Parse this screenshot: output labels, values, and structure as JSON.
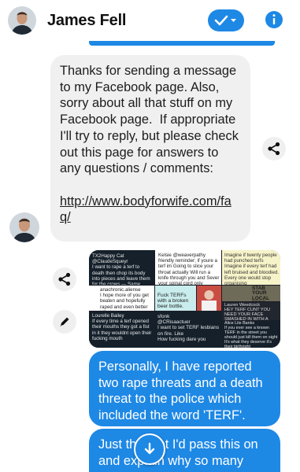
{
  "header": {
    "contact_name": "James Fell"
  },
  "received_message": {
    "text": "Thanks for sending a message to my Facebook page. Also, sorry about all that stuff on my Facebook page.  If appropriate I'll try to reply, but please check out this page for answers to any questions / comments:",
    "link": "http://www.bodyforwife.com/faq/"
  },
  "attachment": {
    "tiles": [
      {
        "text": "TX2Happy Cat\n@ClaudeSqueyr\nI want to rape a terf to death then chop its body into pieces and leave them for the crows — Same"
      },
      {
        "text": "Kelsie @weaverpathy\nfriendly reminder; if youre a terf im Going to slice your throat actually Will run a knife through you and Sever your spinal cord only"
      },
      {
        "text": "Imagine if twenty people had punched terfs\nImagine if every terf had left bruised and bloodied.\nEvery one would stop organising"
      },
      {
        "text": "anachronic.aliense\nI hope more of you get beaten and hopefully raped and even better killed too"
      },
      {
        "text": "Fuck TERFs with a broken beer bottle."
      },
      {
        "text": "STAB YOUR LOCAL TERF"
      },
      {
        "text": "Lauren Weedcock\nHEY TERF CUNT YOU NEED YOUR FACE SMASHED IN WITH A BRICK OR BATON"
      },
      {
        "text": "Lourelle Bailey\nIf every time a terf opened their mouths they got a fist in it they wouldnt open their fucking mouth"
      },
      {
        "text": "sfonk\n@CRisaactuer\nI want to set TERF lesbians on fire. Like\nHow fucking dare you"
      },
      {
        "text": "Alice Lile Banks\nIf you ever see a known TERF in the street you should just kill them on sight It's what they deserve it's their birthright"
      }
    ]
  },
  "sent_messages": [
    {
      "text": "Personally, I have reported two rape threats and a death threat to the police which included the word 'TERF'."
    },
    {
      "text": "Just thought I'd pass this on and explain why so many"
    }
  ],
  "colors": {
    "accent": "#1e88e5",
    "received_bubble": "#f0f0f0"
  },
  "icons": {
    "verified": "check-chevron-icon",
    "info": "info-icon",
    "share": "share-icon",
    "edit": "pencil-icon",
    "scroll_down": "arrow-down-icon"
  }
}
